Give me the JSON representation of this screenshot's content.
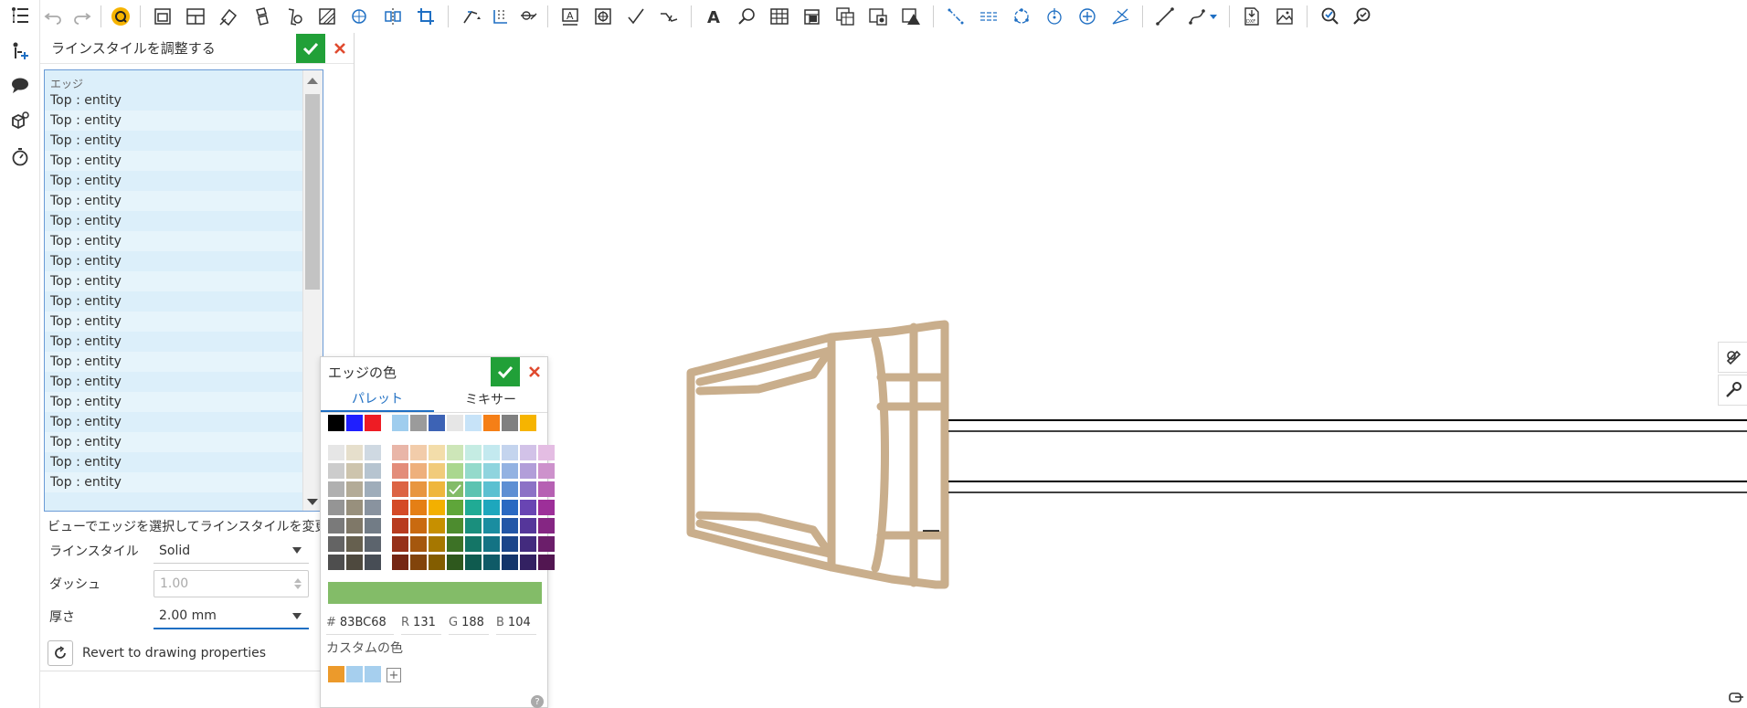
{
  "toolbar": {
    "groups": [
      [
        "undo-icon",
        "redo-icon"
      ],
      [
        "regenerate-icon"
      ],
      [
        "insert-view-icon",
        "projected-view-icon",
        "auxiliary-view-icon",
        "section-view-icon",
        "detail-view-icon",
        "broken-view-icon",
        "crop-view-icon",
        "hatch-icon",
        "rotate-view-icon",
        "move-view-icon",
        "crop-icon"
      ],
      [
        "dimension-icon",
        "ordinate-dimension-icon",
        "angle-dimension-icon"
      ],
      [
        "note-icon",
        "callout-icon",
        "check-mark-icon",
        "leader-icon"
      ],
      [
        "text-icon",
        "search-icon",
        "table-icon",
        "bom-table-icon",
        "hole-table-icon",
        "weld-table-icon",
        "revision-table-icon"
      ],
      [
        "centerline-icon",
        "center-mark-icon",
        "bolt-circle-icon",
        "point-icon",
        "center-point-icon",
        "bisector-icon"
      ],
      [
        "line-icon",
        "spline-icon"
      ],
      [
        "export-dxf-icon",
        "export-image-icon"
      ],
      [
        "check-drawing-icon",
        "inspect-icon"
      ]
    ]
  },
  "dialog": {
    "title": "ラインスタイルを調整する",
    "list_label": "エッジ",
    "edges": [
      "Top : entity",
      "Top : entity",
      "Top : entity",
      "Top : entity",
      "Top : entity",
      "Top : entity",
      "Top : entity",
      "Top : entity",
      "Top : entity",
      "Top : entity",
      "Top : entity",
      "Top : entity",
      "Top : entity",
      "Top : entity",
      "Top : entity",
      "Top : entity",
      "Top : entity",
      "Top : entity",
      "Top : entity",
      "Top : entity"
    ],
    "hint": "ビューでエッジを選択してラインスタイルを変更",
    "line_style_label": "ラインスタイル",
    "line_style_value": "Solid",
    "dash_label": "ダッシュ",
    "dash_value": "1.00",
    "thickness_label": "厚さ",
    "thickness_value": "2.00 mm",
    "revert_label": "Revert to drawing properties"
  },
  "color_picker": {
    "title": "エッジの色",
    "tab_palette": "パレット",
    "tab_mixer": "ミキサー",
    "top_row": [
      "#000000",
      "#1f1fff",
      "#ee1c24",
      "#9fcdee",
      "#9b9b9b",
      "#3d63b5",
      "#e6e6e6",
      "#c7e3f8",
      "#f57f17",
      "#808080",
      "#f6b400"
    ],
    "gray_grid": [
      [
        "#e6e6e6",
        "#e6dfcc",
        "#cfd9e2"
      ],
      [
        "#cccccc",
        "#cdc4ad",
        "#b6c4d0"
      ],
      [
        "#b0b0b0",
        "#b3ab97",
        "#9fadba"
      ],
      [
        "#959595",
        "#98907d",
        "#89939f"
      ],
      [
        "#7a7a7a",
        "#7f7868",
        "#727c86"
      ],
      [
        "#646464",
        "#66604f",
        "#5c646d"
      ],
      [
        "#4e4e4e",
        "#4e493e",
        "#474d55"
      ]
    ],
    "color_grid": [
      [
        "#e9b6a8",
        "#f2ccaa",
        "#f3ddaa",
        "#cde6b8",
        "#c5ece3",
        "#c3e9ef",
        "#c4d4ee",
        "#d2c2e8",
        "#e4bde3"
      ],
      [
        "#e38d7a",
        "#eeb07c",
        "#f1cb7b",
        "#aad78f",
        "#94dacb",
        "#8fd4de",
        "#93b2e2",
        "#b29ed9",
        "#cd92cc"
      ],
      [
        "#dc6444",
        "#e8963f",
        "#efb63d",
        "#83bc68",
        "#5cc3b1",
        "#5bc0d1",
        "#5e8fd3",
        "#8c72c6",
        "#b661b3"
      ],
      [
        "#d44a27",
        "#e57f15",
        "#f3b000",
        "#5fa63a",
        "#20ab95",
        "#1ea7bd",
        "#2a69c2",
        "#6945b3",
        "#9d2f99"
      ],
      [
        "#b83b1f",
        "#c96a10",
        "#c79000",
        "#4d8c2f",
        "#1a8f7d",
        "#1a8da0",
        "#2256a7",
        "#55369a",
        "#852683"
      ],
      [
        "#963019",
        "#a5570e",
        "#a67700",
        "#3d7226",
        "#147566",
        "#147384",
        "#1b458a",
        "#432b7e",
        "#6b1e6a"
      ],
      [
        "#752613",
        "#82440b",
        "#835d00",
        "#2e581d",
        "#0f5b4f",
        "#0f5a67",
        "#14356b",
        "#332162",
        "#521651"
      ]
    ],
    "selected_color": "#83BC68",
    "hex_label": "#",
    "hex_value": "83BC68",
    "r_label": "R",
    "r_value": "131",
    "g_label": "G",
    "g_value": "188",
    "b_label": "B",
    "b_value": "104",
    "custom_label": "カスタムの色",
    "custom_colors": [
      "#ec9a2b",
      "#a6cfee",
      "#a6cfee"
    ],
    "add_symbol": "+",
    "help_symbol": "?"
  },
  "drawing": {
    "part_color": "#c9ae8c",
    "edge_line_color": "#000000"
  }
}
